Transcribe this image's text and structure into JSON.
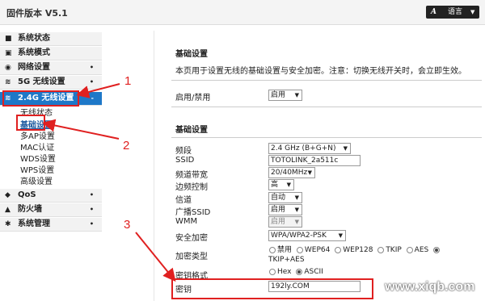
{
  "header": {
    "title": "固件版本 V5.1",
    "lang_icon": "A",
    "lang_label": "语言",
    "lang_caret": "▼"
  },
  "sidebar": {
    "items": [
      {
        "icon": "■",
        "label": "系统状态",
        "arrow": ""
      },
      {
        "icon": "▣",
        "label": "系统模式",
        "arrow": ""
      },
      {
        "icon": "◉",
        "label": "网络设置",
        "arrow": "•"
      },
      {
        "icon": "≋",
        "label": "5G 无线设置",
        "arrow": "•"
      },
      {
        "icon": "≋",
        "label": "2.4G 无线设置",
        "arrow": "-"
      },
      {
        "icon": "◆",
        "label": "QoS",
        "arrow": "•"
      },
      {
        "icon": "▲",
        "label": "防火墙",
        "arrow": "•"
      },
      {
        "icon": "✱",
        "label": "系统管理",
        "arrow": "•"
      }
    ],
    "sub_items": [
      "无线状态",
      "基础设置",
      "多AP设置",
      "MAC认证",
      "WDS设置",
      "WPS设置",
      "高级设置"
    ]
  },
  "main": {
    "section1_title": "基础设置",
    "description": "本页用于设置无线的基础设置与安全加密。注意：切换无线开关时，会立即生效。",
    "enable_label": "启用/禁用",
    "enable_value": "启用",
    "section2_title": "基础设置",
    "fields": {
      "band_label": "频段",
      "band_value": "2.4 GHz (B+G+N)",
      "ssid_label": "SSID",
      "ssid_value": "TOTOLINK_2a511c",
      "bw_label": "频道带宽",
      "bw_value": "20/40MHz",
      "sb_label": "边频控制",
      "sb_value": "高",
      "ch_label": "信道",
      "ch_value": "自动",
      "bc_label": "广播SSID",
      "bc_value": "启用",
      "wmm_label": "WMM",
      "wmm_value": "启用",
      "sec_label": "安全加密",
      "sec_value": "WPA/WPA2-PSK",
      "enc_label": "加密类型",
      "enc_options": [
        "禁用",
        "WEP64",
        "WEP128",
        "TKIP",
        "AES"
      ],
      "enc_options2": "TKIP+AES",
      "kf_label": "密钥格式",
      "kf_options": [
        "Hex",
        "ASCII"
      ],
      "key_label": "密钥",
      "key_value": "192ly.COM"
    }
  },
  "annotations": [
    "1",
    "2",
    "3"
  ],
  "watermark": "www.xiqb.com",
  "colors": {
    "accent": "#1e78c8",
    "annotation": "#e02020"
  }
}
